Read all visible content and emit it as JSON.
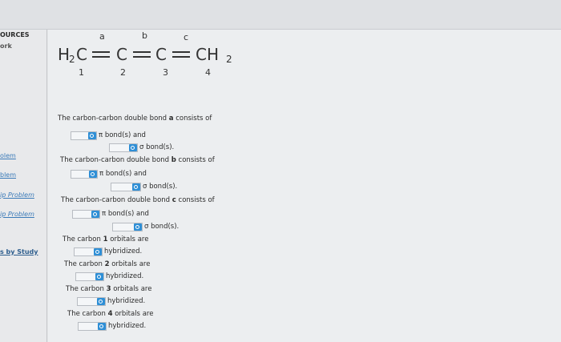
{
  "sidebar": {
    "heading1": "OURCES",
    "heading2": "ork",
    "links": [
      "olem",
      "blem",
      "ip Problem",
      "ip Problem"
    ],
    "study": "s by Study"
  },
  "structure": {
    "left": "H",
    "left_sub": "2",
    "c_left": "C",
    "c2": "C",
    "c3": "C",
    "right": "CH",
    "right_sub": "2",
    "bond_labels": [
      "a",
      "b",
      "c"
    ],
    "atom_numbers": [
      "1",
      "2",
      "3",
      "4"
    ]
  },
  "questions": {
    "a_prefix": "The carbon-carbon double bond ",
    "a_letter": "a",
    "a_suffix": " consists of",
    "b_prefix": "The carbon-carbon double bond ",
    "b_letter": "b",
    "b_suffix": " consists of",
    "c_prefix": "The carbon-carbon double bond ",
    "c_letter": "c",
    "c_suffix": " consists of",
    "pi_text": "π bond(s) and",
    "sigma_text": "σ bond(s).",
    "c1_prefix": "The carbon ",
    "c1_num": "1",
    "c1_suffix": " orbitals are",
    "c2_prefix": "The carbon ",
    "c2_num": "2",
    "c2_suffix": " orbitals are",
    "c3_prefix": "The carbon ",
    "c3_num": "3",
    "c3_suffix": " orbitals are",
    "c4_prefix": "The carbon ",
    "c4_num": "4",
    "c4_suffix": " orbitals are",
    "hybridized": "hybridized."
  }
}
